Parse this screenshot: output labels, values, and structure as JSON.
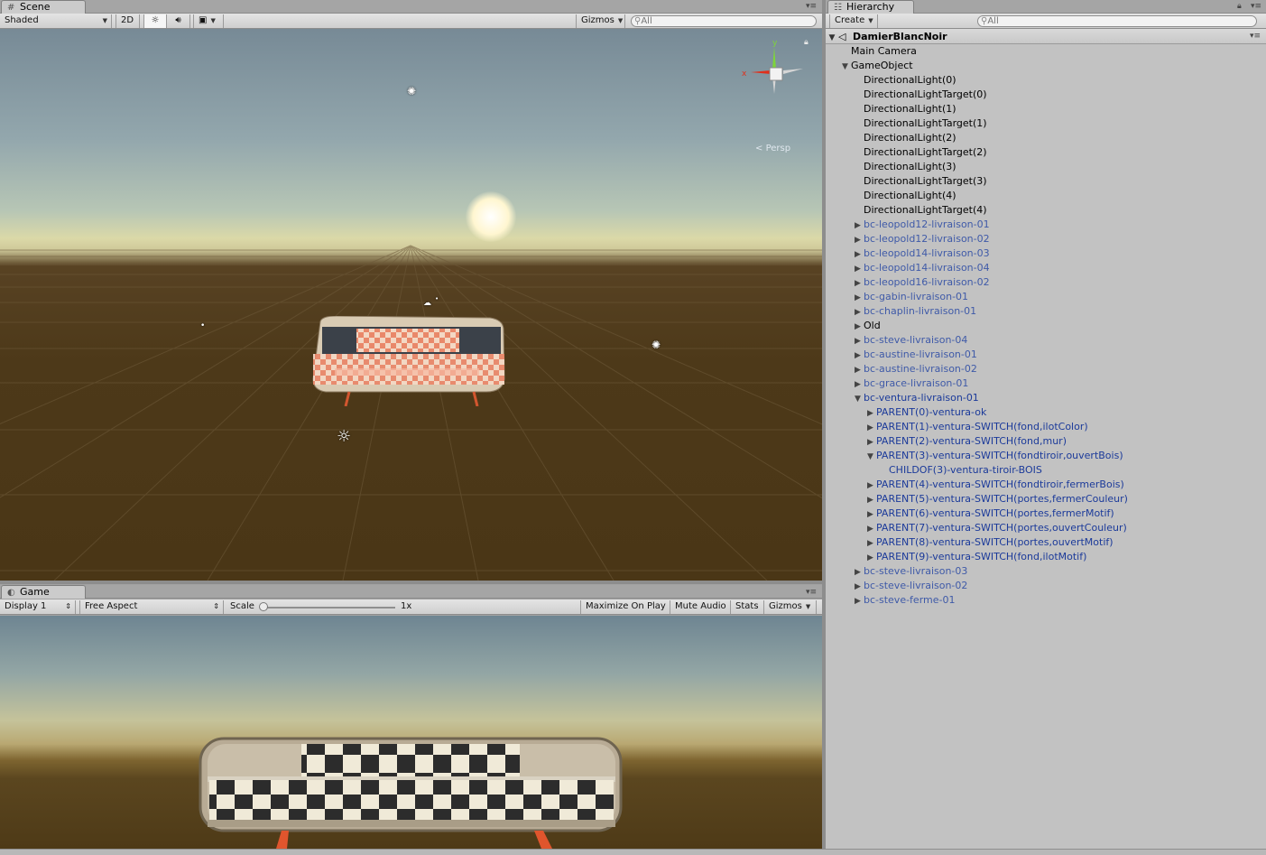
{
  "scene_panel": {
    "tab_label": "Scene",
    "shading_mode": "Shaded",
    "mode_2d_label": "2D",
    "gizmos_label": "Gizmos",
    "search_placeholder": "All",
    "persp_label": "Persp",
    "gizmo_axes": {
      "x": "x",
      "y": "y"
    }
  },
  "game_panel": {
    "tab_label": "Game",
    "display": "Display 1",
    "aspect": "Free Aspect",
    "scale_label": "Scale",
    "scale_value": "1x",
    "maximize_on_play": "Maximize On Play",
    "mute_audio": "Mute Audio",
    "stats": "Stats",
    "gizmos_label": "Gizmos"
  },
  "hierarchy_panel": {
    "tab_label": "Hierarchy",
    "create_label": "Create",
    "search_placeholder": "All",
    "scene_name": "DamierBlancNoir",
    "items": [
      {
        "label": "Main Camera",
        "depth": 1,
        "fold": "",
        "kind": "object"
      },
      {
        "label": "GameObject",
        "depth": 1,
        "fold": "open",
        "kind": "object"
      },
      {
        "label": "DirectionalLight(0)",
        "depth": 2,
        "fold": "",
        "kind": "object"
      },
      {
        "label": "DirectionalLightTarget(0)",
        "depth": 2,
        "fold": "",
        "kind": "object"
      },
      {
        "label": "DirectionalLight(1)",
        "depth": 2,
        "fold": "",
        "kind": "object"
      },
      {
        "label": "DirectionalLightTarget(1)",
        "depth": 2,
        "fold": "",
        "kind": "object"
      },
      {
        "label": "DirectionalLight(2)",
        "depth": 2,
        "fold": "",
        "kind": "object"
      },
      {
        "label": "DirectionalLightTarget(2)",
        "depth": 2,
        "fold": "",
        "kind": "object"
      },
      {
        "label": "DirectionalLight(3)",
        "depth": 2,
        "fold": "",
        "kind": "object"
      },
      {
        "label": "DirectionalLightTarget(3)",
        "depth": 2,
        "fold": "",
        "kind": "object"
      },
      {
        "label": "DirectionalLight(4)",
        "depth": 2,
        "fold": "",
        "kind": "object"
      },
      {
        "label": "DirectionalLightTarget(4)",
        "depth": 2,
        "fold": "",
        "kind": "object"
      },
      {
        "label": "bc-leopold12-livraison-01",
        "depth": 2,
        "fold": "closed",
        "kind": "prefab-dim"
      },
      {
        "label": "bc-leopold12-livraison-02",
        "depth": 2,
        "fold": "closed",
        "kind": "prefab-dim"
      },
      {
        "label": "bc-leopold14-livraison-03",
        "depth": 2,
        "fold": "closed",
        "kind": "prefab-dim"
      },
      {
        "label": "bc-leopold14-livraison-04",
        "depth": 2,
        "fold": "closed",
        "kind": "prefab-dim"
      },
      {
        "label": "bc-leopold16-livraison-02",
        "depth": 2,
        "fold": "closed",
        "kind": "prefab-dim"
      },
      {
        "label": "bc-gabin-livraison-01",
        "depth": 2,
        "fold": "closed",
        "kind": "prefab-dim"
      },
      {
        "label": "bc-chaplin-livraison-01",
        "depth": 2,
        "fold": "closed",
        "kind": "prefab-dim"
      },
      {
        "label": "Old",
        "depth": 2,
        "fold": "closed",
        "kind": "object"
      },
      {
        "label": "bc-steve-livraison-04",
        "depth": 2,
        "fold": "closed",
        "kind": "prefab-dim"
      },
      {
        "label": "bc-austine-livraison-01",
        "depth": 2,
        "fold": "closed",
        "kind": "prefab-dim"
      },
      {
        "label": "bc-austine-livraison-02",
        "depth": 2,
        "fold": "closed",
        "kind": "prefab-dim"
      },
      {
        "label": "bc-grace-livraison-01",
        "depth": 2,
        "fold": "closed",
        "kind": "prefab-dim"
      },
      {
        "label": "bc-ventura-livraison-01",
        "depth": 2,
        "fold": "open",
        "kind": "prefab"
      },
      {
        "label": "PARENT(0)-ventura-ok",
        "depth": 3,
        "fold": "closed",
        "kind": "prefab"
      },
      {
        "label": "PARENT(1)-ventura-SWITCH(fond,ilotColor)",
        "depth": 3,
        "fold": "closed",
        "kind": "prefab"
      },
      {
        "label": "PARENT(2)-ventura-SWITCH(fond,mur)",
        "depth": 3,
        "fold": "closed",
        "kind": "prefab"
      },
      {
        "label": "PARENT(3)-ventura-SWITCH(fondtiroir,ouvertBois)",
        "depth": 3,
        "fold": "open",
        "kind": "prefab"
      },
      {
        "label": "CHILDOF(3)-ventura-tiroir-BOIS",
        "depth": 4,
        "fold": "",
        "kind": "prefab"
      },
      {
        "label": "PARENT(4)-ventura-SWITCH(fondtiroir,fermerBois)",
        "depth": 3,
        "fold": "closed",
        "kind": "prefab"
      },
      {
        "label": "PARENT(5)-ventura-SWITCH(portes,fermerCouleur)",
        "depth": 3,
        "fold": "closed",
        "kind": "prefab"
      },
      {
        "label": "PARENT(6)-ventura-SWITCH(portes,fermerMotif)",
        "depth": 3,
        "fold": "closed",
        "kind": "prefab"
      },
      {
        "label": "PARENT(7)-ventura-SWITCH(portes,ouvertCouleur)",
        "depth": 3,
        "fold": "closed",
        "kind": "prefab"
      },
      {
        "label": "PARENT(8)-ventura-SWITCH(portes,ouvertMotif)",
        "depth": 3,
        "fold": "closed",
        "kind": "prefab"
      },
      {
        "label": "PARENT(9)-ventura-SWITCH(fond,ilotMotif)",
        "depth": 3,
        "fold": "closed",
        "kind": "prefab"
      },
      {
        "label": "bc-steve-livraison-03",
        "depth": 2,
        "fold": "closed",
        "kind": "prefab-dim"
      },
      {
        "label": "bc-steve-livraison-02",
        "depth": 2,
        "fold": "closed",
        "kind": "prefab-dim"
      },
      {
        "label": "bc-steve-ferme-01",
        "depth": 2,
        "fold": "closed",
        "kind": "prefab-dim"
      }
    ]
  },
  "colors": {
    "prefab_text": "#1b3a9a",
    "gizmo_x": "#e0301c",
    "gizmo_y": "#7ed43a"
  }
}
